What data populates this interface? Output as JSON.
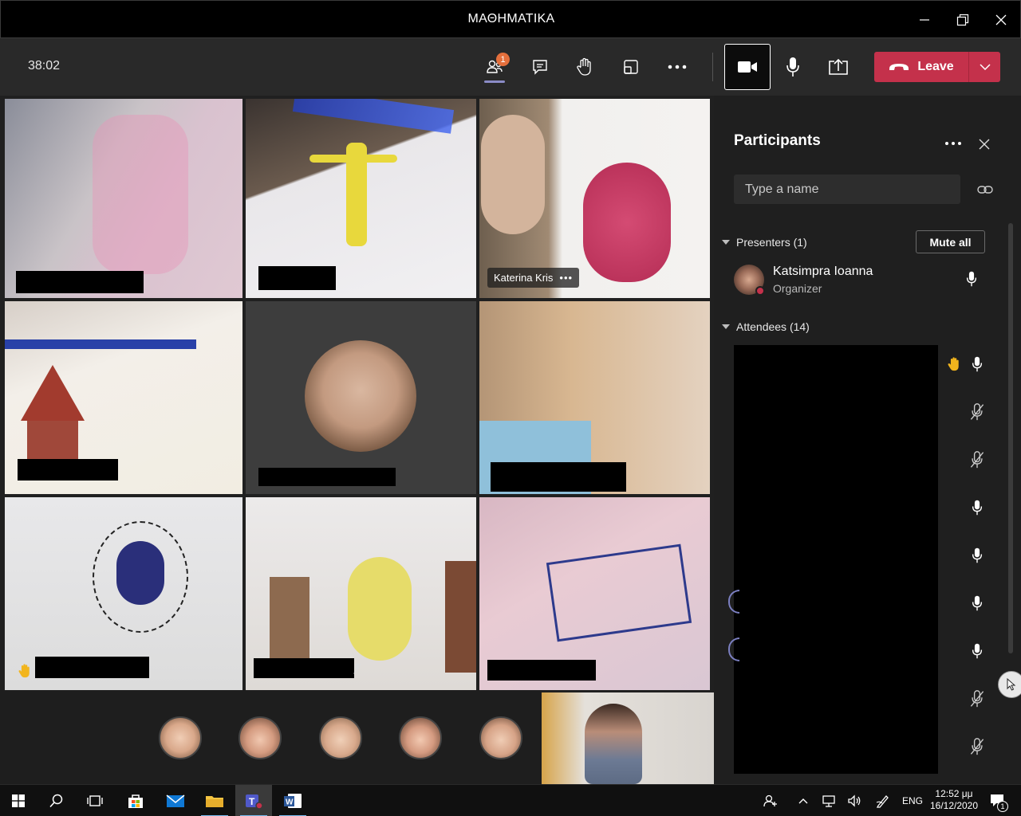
{
  "window": {
    "title": "ΜΑΘΗΜΑΤΙΚΑ"
  },
  "toolbar": {
    "timer": "38:02",
    "participants_badge": "1",
    "leave_label": "Leave"
  },
  "tiles": [
    {
      "id": "t1",
      "name": ""
    },
    {
      "id": "t2",
      "name": ""
    },
    {
      "id": "t3",
      "name": "Katerina Kris"
    },
    {
      "id": "t4",
      "name": ""
    },
    {
      "id": "t5",
      "name": ""
    },
    {
      "id": "t6",
      "name": ""
    },
    {
      "id": "t7",
      "name": "",
      "hand_raised": true
    },
    {
      "id": "t8",
      "name": "",
      "muted": true
    },
    {
      "id": "t9",
      "name": ""
    }
  ],
  "panel": {
    "title": "Participants",
    "search_placeholder": "Type a name",
    "presenters_header": "Presenters (1)",
    "mute_all_label": "Mute all",
    "presenter": {
      "name": "Katsimpra Ioanna",
      "role": "Organizer"
    },
    "attendees_header": "Attendees (14)",
    "attendee_mics": [
      "hand-mic",
      "muted",
      "muted",
      "mic",
      "mic",
      "mic",
      "mic",
      "muted",
      "muted"
    ]
  },
  "taskbar": {
    "language": "ENG",
    "time": "12:52 μμ",
    "date": "16/12/2020",
    "notifications": "1"
  },
  "colors": {
    "leave_red": "#c4314b",
    "badge_orange": "#e46f3c",
    "accent_purple": "#8b8cc7",
    "panel_bg": "#1f1f1f"
  }
}
